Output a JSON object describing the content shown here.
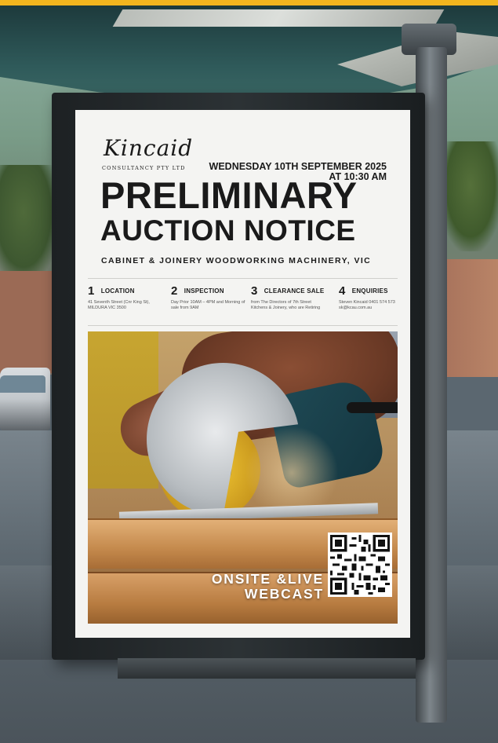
{
  "poster": {
    "logo": {
      "script": "Kincaid",
      "sub": "CONSULTANCY PTY LTD"
    },
    "date": {
      "line1": "WEDNESDAY 10TH SEPTEMBER 2025",
      "line2": "AT 10:30 AM"
    },
    "title": {
      "line1": "PRELIMINARY",
      "line2": "AUCTION NOTICE"
    },
    "subtitle": "CABINET & JOINERY WOODWORKING MACHINERY, VIC",
    "info": [
      {
        "num": "1",
        "heading": "LOCATION",
        "body": "41 Seventh Street (Cnr King St), MILDURA VIC 3500"
      },
      {
        "num": "2",
        "heading": "INSPECTION",
        "body": "Day Prior 10AM – 4PM and Morning of sale from 9AM"
      },
      {
        "num": "3",
        "heading": "CLEARANCE SALE",
        "body": "from The Directors of 7th Street Kitchens & Joinery, who are Retiring"
      },
      {
        "num": "4",
        "heading": "ENQUIRIES",
        "body": "Steven Kincaid 0401 574 573 sk@kcau.com.au"
      }
    ],
    "webcast": {
      "line1": "ONSITE &LIVE",
      "line2": "WEBCAST"
    },
    "qr_icon": "qr-code-icon"
  },
  "colors": {
    "accent_bar": "#f2b51e",
    "poster_bg": "#f4f4f2",
    "ink": "#1a1a1a",
    "frame": "#2c3235"
  }
}
